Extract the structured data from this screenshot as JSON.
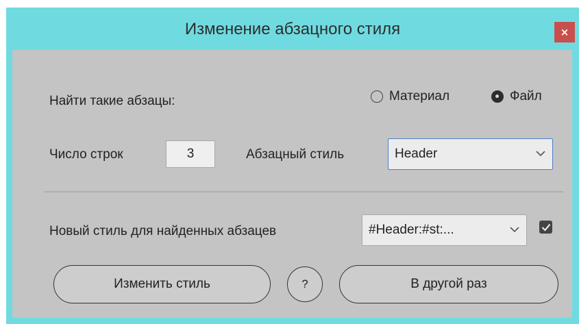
{
  "window": {
    "title": "Изменение абзацного стиля",
    "close_label": "×"
  },
  "find": {
    "label": "Найти такие абзацы:",
    "options": [
      {
        "label": "Материал",
        "selected": false
      },
      {
        "label": "Файл",
        "selected": true
      }
    ]
  },
  "lines": {
    "label": "Число строк",
    "value": "3"
  },
  "paragraph_style": {
    "label": "Абзацный стиль",
    "value": "Header"
  },
  "new_style": {
    "label": "Новый стиль для найденных абзацев",
    "value": "#Header:#st:...",
    "checked": true
  },
  "buttons": {
    "change": "Изменить стиль",
    "help": "?",
    "later": "В другой раз"
  },
  "colors": {
    "title_bar": "#6fdbe0",
    "body": "#c4c4c4",
    "close": "#c94f4f",
    "focus": "#4f7fc9"
  }
}
